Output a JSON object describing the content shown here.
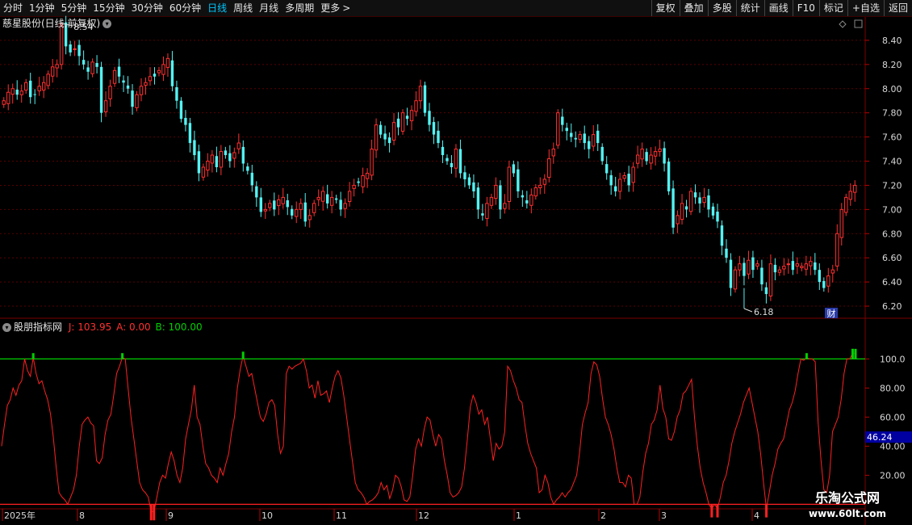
{
  "toolbar": {
    "periods": [
      "分时",
      "1分钟",
      "5分钟",
      "15分钟",
      "30分钟",
      "60分钟",
      "日线",
      "周线",
      "月线",
      "多周期",
      "更多"
    ],
    "active_period": "日线",
    "more_arrow": ">",
    "buttons": [
      "复权",
      "叠加",
      "多股",
      "统计",
      "画线",
      "F10",
      "标记",
      "+自选",
      "返回"
    ]
  },
  "stock": {
    "title": "慈星股份(日线,前复权)"
  },
  "indicator": {
    "name": "股朋指标网",
    "j_label": "J:",
    "j_value": "103.95",
    "a_label": "A:",
    "a_value": "0.00",
    "b_label": "B:",
    "b_value": "100.00"
  },
  "price_axis": {
    "ticks": [
      "8.40",
      "8.20",
      "8.00",
      "7.80",
      "7.60",
      "7.40",
      "7.20",
      "7.00",
      "6.80",
      "6.60",
      "6.40",
      "6.20"
    ]
  },
  "ind_axis": {
    "ticks": [
      "100.0",
      "80.00",
      "60.00",
      "40.00",
      "20.00"
    ],
    "current_label": "46.24"
  },
  "date_axis": {
    "labels": [
      "2025年",
      "8",
      "9",
      "10",
      "11",
      "12",
      "1",
      "2",
      "3",
      "4"
    ]
  },
  "annotations": {
    "high_label": "8.54",
    "low_label": "6.18",
    "finance_badge": "财"
  },
  "watermark": {
    "line1": "乐淘公式网",
    "line2": "www.60lt.com"
  },
  "colors": {
    "up": "#ff3030",
    "down": "#54f2f2",
    "indicator_line": "#ff2020",
    "threshold_line": "#00d000",
    "grid": "#5a0000",
    "active_tab": "#00c8ff",
    "axis_highlight": "#0000a0"
  },
  "chart_data": [
    {
      "type": "candlestick",
      "title": "慈星股份(日线,前复权)",
      "y_axis_ticks": [
        8.4,
        8.2,
        8.0,
        7.8,
        7.6,
        7.4,
        7.2,
        7.0,
        6.8,
        6.6,
        6.4,
        6.2
      ],
      "ylim": [
        6.12,
        8.58
      ],
      "highest": 8.54,
      "lowest": 6.18,
      "closes": [
        7.9,
        7.97,
        8.0,
        7.95,
        7.98,
        8.05,
        7.93,
        7.95,
        8.02,
        8.05,
        8.12,
        8.18,
        8.2,
        8.54,
        8.35,
        8.3,
        8.33,
        8.27,
        8.2,
        8.14,
        8.22,
        8.18,
        7.8,
        7.9,
        8.02,
        8.15,
        8.1,
        8.05,
        8.0,
        7.85,
        7.95,
        8.02,
        8.05,
        8.1,
        8.1,
        8.15,
        8.2,
        8.25,
        8.02,
        7.9,
        7.75,
        7.7,
        7.55,
        7.45,
        7.3,
        7.35,
        7.4,
        7.45,
        7.35,
        7.48,
        7.45,
        7.4,
        7.47,
        7.55,
        7.38,
        7.32,
        7.2,
        7.1,
        6.98,
        7.0,
        7.05,
        7.0,
        7.08,
        7.1,
        7.02,
        6.95,
        7.0,
        7.05,
        6.9,
        6.95,
        7.05,
        7.1,
        7.15,
        7.05,
        7.1,
        7.08,
        7.0,
        7.05,
        7.15,
        7.2,
        7.22,
        7.28,
        7.3,
        7.5,
        7.7,
        7.62,
        7.58,
        7.55,
        7.72,
        7.68,
        7.8,
        7.75,
        7.82,
        7.9,
        8.02,
        7.8,
        7.7,
        7.62,
        7.55,
        7.45,
        7.4,
        7.35,
        7.5,
        7.3,
        7.25,
        7.2,
        7.15,
        7.0,
        6.95,
        7.05,
        7.1,
        7.2,
        7.0,
        7.05,
        7.35,
        7.3,
        7.15,
        7.1,
        7.05,
        7.12,
        7.18,
        7.2,
        7.25,
        7.42,
        7.5,
        7.8,
        7.7,
        7.65,
        7.6,
        7.58,
        7.62,
        7.55,
        7.5,
        7.62,
        7.55,
        7.4,
        7.3,
        7.2,
        7.15,
        7.25,
        7.28,
        7.2,
        7.35,
        7.45,
        7.5,
        7.4,
        7.45,
        7.48,
        7.5,
        7.38,
        7.15,
        6.85,
        6.95,
        7.05,
        7.0,
        7.15,
        7.1,
        7.05,
        7.1,
        7.0,
        6.95,
        6.9,
        6.7,
        6.6,
        6.35,
        6.5,
        6.55,
        6.45,
        6.58,
        6.5,
        6.55,
        6.38,
        6.3,
        6.55,
        6.48,
        6.5,
        6.53,
        6.55,
        6.5,
        6.55,
        6.53,
        6.55,
        6.57,
        6.5,
        6.4,
        6.35,
        6.45,
        6.5,
        6.8,
        7.0,
        7.1,
        7.15,
        7.2
      ],
      "x_axis_labels": [
        "2025年",
        "8",
        "9",
        "10",
        "11",
        "12",
        "1",
        "2",
        "3",
        "4"
      ]
    },
    {
      "type": "line",
      "title": "股朋指标网",
      "series": [
        {
          "name": "J",
          "last_value": 103.95
        },
        {
          "name": "A",
          "last_value": 0.0
        },
        {
          "name": "B",
          "last_value": 100.0
        }
      ],
      "y_axis_ticks": [
        100,
        80,
        60,
        40,
        20
      ],
      "ylim": [
        -2,
        118
      ],
      "current_label": 46.24,
      "j_values": [
        40,
        55,
        68,
        72,
        80,
        75,
        82,
        85,
        100,
        92,
        88,
        101,
        90,
        83,
        85,
        78,
        72,
        62,
        46,
        25,
        8,
        5,
        3,
        0,
        5,
        10,
        20,
        40,
        55,
        58,
        60,
        56,
        54,
        30,
        28,
        32,
        48,
        58,
        62,
        75,
        90,
        95,
        101,
        100,
        80,
        60,
        45,
        30,
        15,
        10,
        8,
        5,
        -5,
        -5,
        5,
        15,
        20,
        18,
        28,
        36,
        30,
        20,
        15,
        25,
        45,
        55,
        65,
        82,
        60,
        55,
        40,
        28,
        25,
        20,
        18,
        15,
        25,
        20,
        28,
        35,
        50,
        60,
        80,
        93,
        102,
        95,
        88,
        90,
        80,
        70,
        60,
        57,
        62,
        70,
        72,
        68,
        48,
        35,
        40,
        90,
        95,
        93,
        95,
        96,
        97,
        100,
        92,
        80,
        82,
        73,
        85,
        75,
        76,
        78,
        70,
        80,
        88,
        92,
        87,
        75,
        60,
        45,
        30,
        15,
        10,
        8,
        5,
        0,
        2,
        3,
        5,
        8,
        15,
        10,
        13,
        4,
        10,
        20,
        18,
        12,
        3,
        2,
        5,
        20,
        38,
        45,
        40,
        52,
        60,
        58,
        48,
        40,
        48,
        45,
        30,
        20,
        8,
        5,
        6,
        8,
        12,
        25,
        45,
        67,
        75,
        70,
        62,
        65,
        55,
        60,
        45,
        30,
        42,
        38,
        40,
        50,
        95,
        92,
        85,
        80,
        72,
        70,
        55,
        42,
        35,
        30,
        25,
        8,
        10,
        20,
        15,
        5,
        0,
        3,
        5,
        8,
        5,
        8,
        10,
        15,
        20,
        35,
        55,
        63,
        70,
        90,
        98,
        96,
        88,
        73,
        60,
        55,
        48,
        38,
        25,
        15,
        15,
        12,
        20,
        18,
        0,
        0,
        5,
        22,
        35,
        42,
        55,
        58,
        65,
        82,
        66,
        60,
        45,
        44,
        50,
        60,
        65,
        76,
        78,
        82,
        86,
        60,
        40,
        25,
        15,
        8,
        0,
        -3,
        0,
        -3,
        5,
        15,
        20,
        30,
        42,
        50,
        56,
        62,
        70,
        75,
        80,
        70,
        60,
        50,
        35,
        15,
        -3,
        8,
        20,
        28,
        38,
        42,
        45,
        55,
        65,
        70,
        78,
        90,
        100,
        99,
        101,
        100,
        100,
        98,
        56,
        30,
        10,
        8,
        20,
        50,
        55,
        60,
        72,
        90,
        100,
        100,
        104,
        103.95
      ]
    }
  ]
}
